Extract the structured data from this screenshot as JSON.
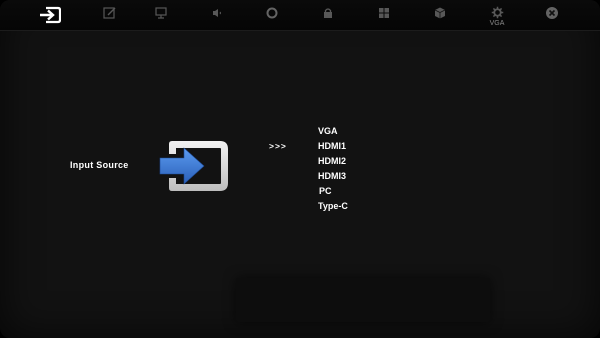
{
  "menu_tabs": [
    {
      "id": "input",
      "icon": "input-source-icon",
      "label": "",
      "active": true
    },
    {
      "id": "picture",
      "icon": "edit-icon",
      "label": ""
    },
    {
      "id": "display",
      "icon": "monitor-icon",
      "label": ""
    },
    {
      "id": "audio",
      "icon": "speaker-icon",
      "label": ""
    },
    {
      "id": "color",
      "icon": "circle-icon",
      "label": ""
    },
    {
      "id": "lock",
      "icon": "lock-icon",
      "label": ""
    },
    {
      "id": "layout",
      "icon": "grid-icon",
      "label": ""
    },
    {
      "id": "power",
      "icon": "cube-icon",
      "label": ""
    },
    {
      "id": "settings",
      "icon": "gear-icon",
      "label": "VGA"
    },
    {
      "id": "close",
      "icon": "close-icon",
      "label": ""
    }
  ],
  "content": {
    "title": "Input Source",
    "indicator": ">>>",
    "sources": [
      "VGA",
      "HDMI1",
      "HDMI2",
      "HDMI3",
      "PC",
      "Type-C"
    ]
  },
  "colors": {
    "background": "#121212",
    "topbar": "#080808",
    "icon_gray": "#8a8a8a",
    "arrow_blue": "#3a76d4",
    "text": "#ffffff"
  }
}
